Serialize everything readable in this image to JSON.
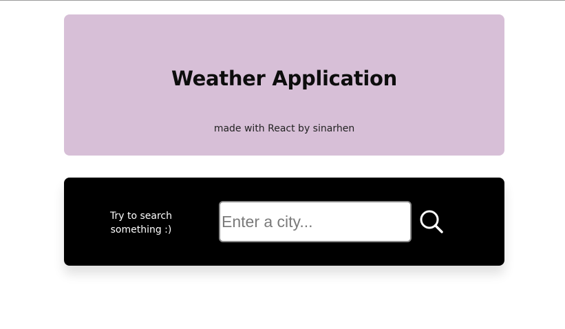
{
  "colors": {
    "header_bg": "#d7bfd7",
    "search_bg": "#000000"
  },
  "header": {
    "title": "Weather Application",
    "subtitle": "made with React by sinarhen"
  },
  "search": {
    "hint_line1": "Try to search",
    "hint_line2": "something :)",
    "placeholder": "Enter a city...",
    "value": "",
    "button_icon": "search-icon"
  }
}
